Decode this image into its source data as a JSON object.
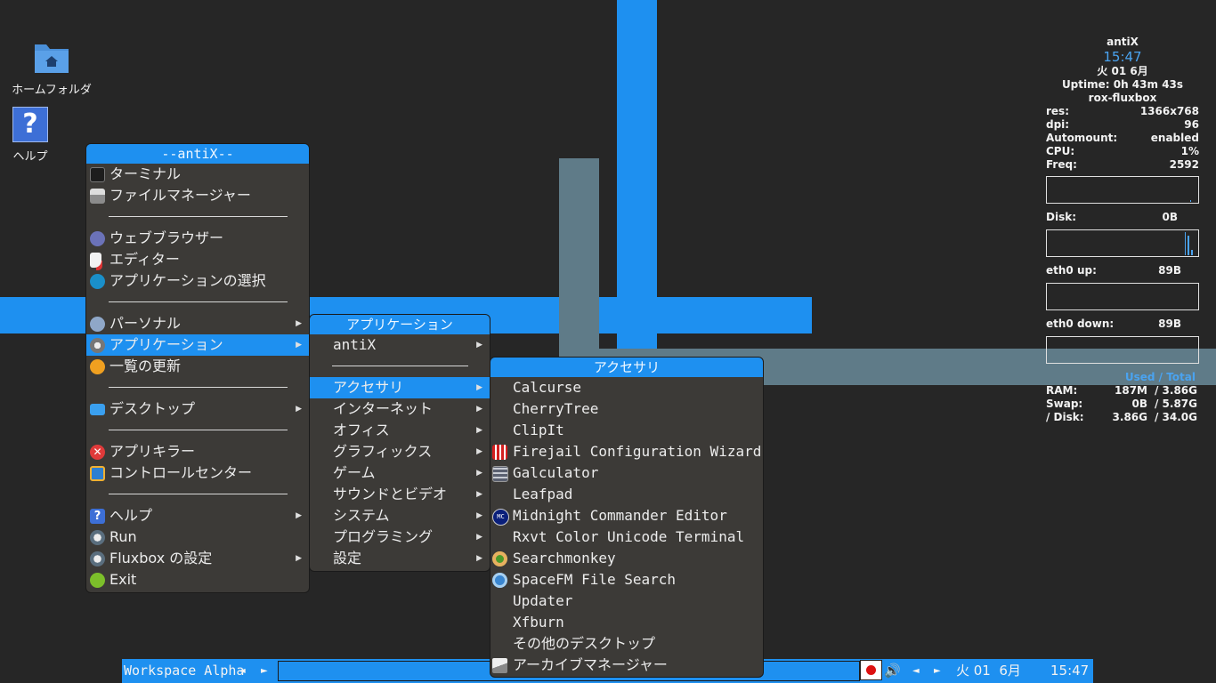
{
  "desktop": {
    "icons": [
      {
        "name": "home-folder",
        "label": "ホームフォルダ"
      },
      {
        "name": "help",
        "label": "ヘルプ",
        "glyph": "?"
      }
    ]
  },
  "conky": {
    "hostname": "antiX",
    "time": "15:47",
    "date": "火 01  6月",
    "uptime": "Uptime: 0h 43m 43s",
    "wm": "rox-fluxbox",
    "stats": [
      {
        "label": "res:",
        "value": "1366x768"
      },
      {
        "label": "dpi:",
        "value": "96"
      },
      {
        "label": "Automount:",
        "value": "enabled"
      },
      {
        "label": "CPU:",
        "value": "1%"
      },
      {
        "label": "Freq:",
        "value": "2592"
      }
    ],
    "disk": {
      "label": "Disk:",
      "value": "0B"
    },
    "eth_up": {
      "label": "eth0 up:",
      "value": "89B"
    },
    "eth_down": {
      "label": "eth0 down:",
      "value": "89B"
    },
    "used_total": "Used / Total",
    "mem": [
      {
        "label": "RAM:",
        "used": "187M",
        "total": "/ 3.86G"
      },
      {
        "label": "Swap:",
        "used": "0B",
        "total": "/ 5.87G"
      },
      {
        "label": "/ Disk:",
        "used": "3.86G",
        "total": "/ 34.0G"
      }
    ]
  },
  "main_menu": {
    "title": "--antiX--",
    "items": [
      {
        "label": "ターミナル",
        "icon": "terminal-icon"
      },
      {
        "label": "ファイルマネージャー",
        "icon": "file-manager-icon"
      },
      {
        "label": "ウェブブラウザー",
        "icon": "web-browser-icon"
      },
      {
        "label": "エディター",
        "icon": "editor-icon"
      },
      {
        "label": "アプリケーションの選択",
        "icon": "app-select-icon"
      },
      {
        "label": "パーソナル",
        "icon": "personal-icon"
      },
      {
        "label": "アプリケーション",
        "icon": "applications-icon"
      },
      {
        "label": "一覧の更新",
        "icon": "refresh-icon"
      },
      {
        "label": "デスクトップ",
        "icon": "desktop-icon"
      },
      {
        "label": "アプリキラー",
        "icon": "app-killer-icon"
      },
      {
        "label": "コントロールセンター",
        "icon": "control-center-icon"
      },
      {
        "label": "ヘルプ",
        "icon": "help-icon"
      },
      {
        "label": "Run",
        "icon": "run-icon"
      },
      {
        "label": "Fluxbox の設定",
        "icon": "fluxbox-settings-icon"
      },
      {
        "label": "Exit",
        "icon": "exit-icon"
      }
    ]
  },
  "apps_menu": {
    "title": "アプリケーション",
    "items": [
      "antiX",
      "アクセサリ",
      "インターネット",
      "オフィス",
      "グラフィックス",
      "ゲーム",
      "サウンドとビデオ",
      "システム",
      "プログラミング",
      "設定"
    ]
  },
  "accessories_menu": {
    "title": "アクセサリ",
    "items": [
      {
        "label": "Calcurse",
        "icon": ""
      },
      {
        "label": "CherryTree",
        "icon": ""
      },
      {
        "label": "ClipIt",
        "icon": ""
      },
      {
        "label": "Firejail Configuration Wizard",
        "icon": "firejail-icon"
      },
      {
        "label": "Galculator",
        "icon": "calculator-icon"
      },
      {
        "label": "Leafpad",
        "icon": ""
      },
      {
        "label": "Midnight Commander Editor",
        "icon": "mc-icon",
        "icon_text": "MC"
      },
      {
        "label": "Rxvt Color Unicode Terminal",
        "icon": ""
      },
      {
        "label": "Searchmonkey",
        "icon": "searchmonkey-icon"
      },
      {
        "label": "SpaceFM File Search",
        "icon": "spacefm-search-icon"
      },
      {
        "label": "Updater",
        "icon": ""
      },
      {
        "label": "Xfburn",
        "icon": ""
      },
      {
        "label": "その他のデスクトップ",
        "icon": ""
      },
      {
        "label": "アーカイブマネージャー",
        "icon": "archive-manager-icon"
      }
    ]
  },
  "taskbar": {
    "workspace": "Workspace Alpha",
    "prev": "◄",
    "next": "►",
    "clock_date": "火 01  6月",
    "clock_time": "15:47",
    "volume_glyph": "🔊"
  },
  "colors": {
    "accent": "#1e90f0",
    "menu_bg": "#3c3a37",
    "desktop_bg": "#262626",
    "stripe_gray": "#5f7b88"
  }
}
